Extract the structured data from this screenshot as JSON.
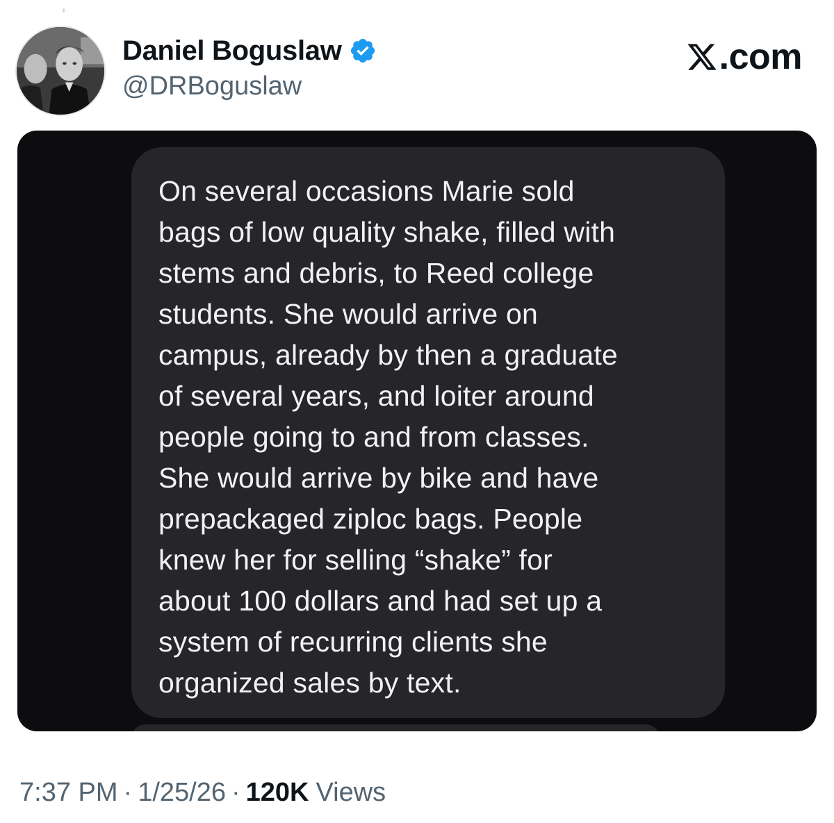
{
  "author": {
    "display_name": "Daniel Boguslaw",
    "handle": "@DRBoguslaw",
    "verified": true
  },
  "brand": {
    "label": ".com",
    "icon": "x-logo-icon"
  },
  "post": {
    "message_text": "On several occasions Marie sold\nbags of low quality shake, filled with\nstems and debris, to Reed college\nstudents. She would arrive on\ncampus, already by then a graduate\nof several years, and loiter around\npeople going to and from classes.\nShe would arrive by bike and have\nprepackaged ziploc bags. People\nknew her for selling “shake” for\nabout 100 dollars and had set up a\nsystem of recurring clients she\norganized sales by text."
  },
  "meta": {
    "time": "7:37 PM",
    "separator": "·",
    "date": "1/25/26",
    "views_count": "120K",
    "views_label": "Views"
  },
  "colors": {
    "verified_blue": "#1d9bf0",
    "text_primary": "#0f1419",
    "text_secondary": "#536471",
    "media_background": "#0d0d10",
    "bubble_background": "#26262a"
  }
}
